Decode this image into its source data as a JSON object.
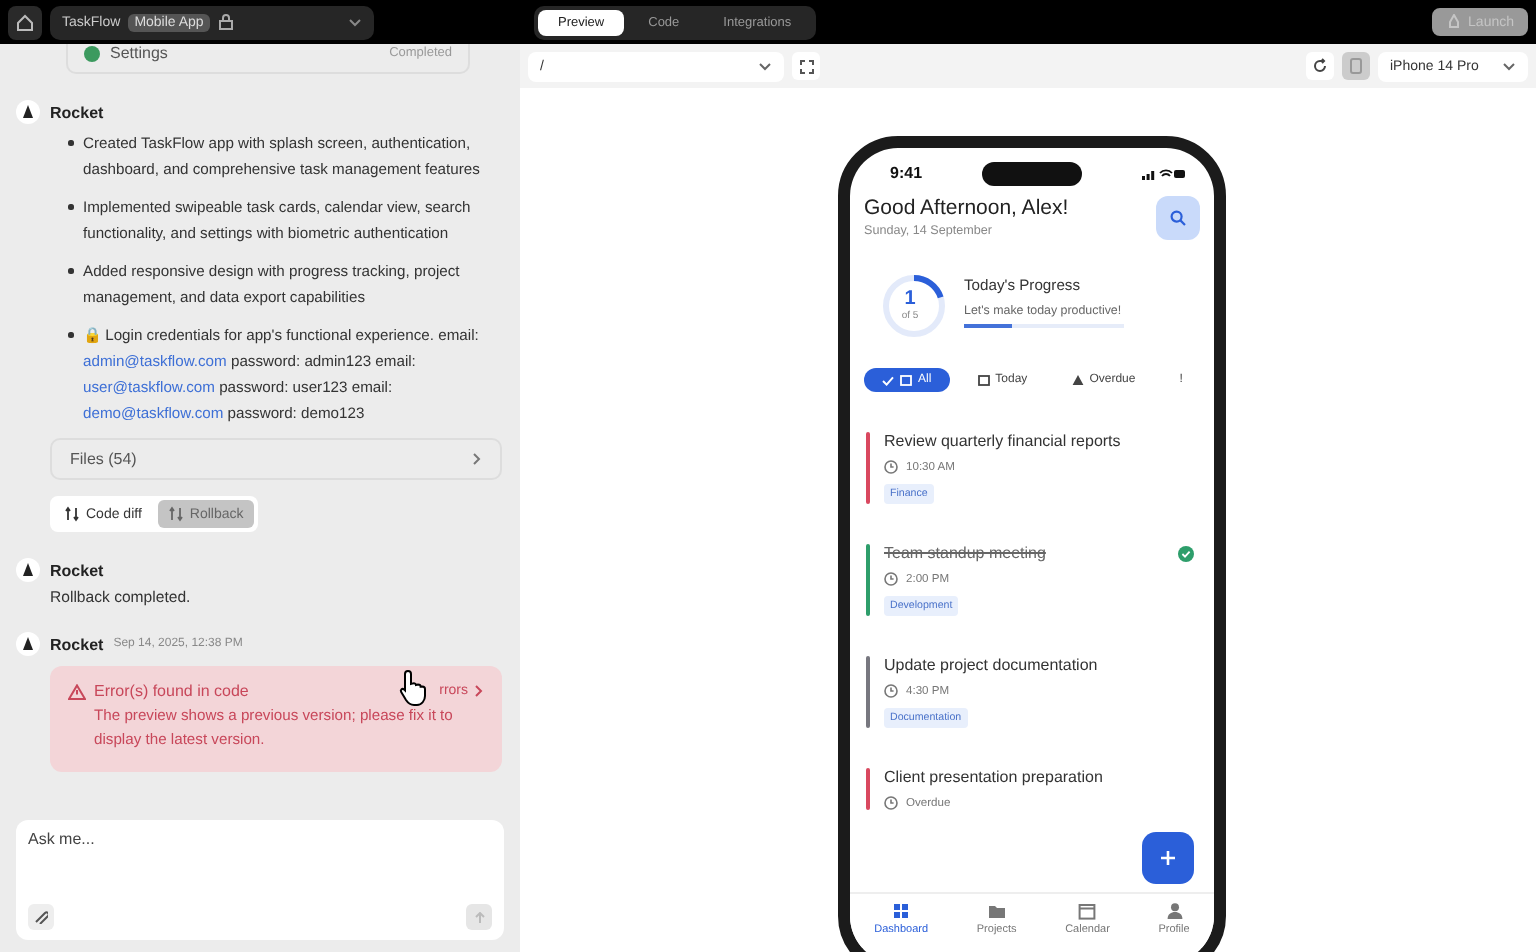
{
  "top_bar": {
    "project_name": "TaskFlow",
    "project_badge": "Mobile App",
    "tabs": [
      {
        "label": "Preview",
        "selected": true
      },
      {
        "label": "Code",
        "selected": false
      },
      {
        "label": "Integrations",
        "selected": false
      }
    ],
    "launch_button": {
      "label": "Launch",
      "disabled": true
    }
  },
  "chat": {
    "prev_item": {
      "label": "Settings",
      "status": "Completed"
    },
    "messages": [
      {
        "kind": "summary",
        "author": "Rocket",
        "bullets": [
          "Created TaskFlow app with splash screen, authentication, dashboard, and comprehensive task management features",
          "Implemented swipeable task cards, calendar view, search functionality, and settings with biometric authentication",
          "Added responsive design with progress tracking, project management, and data export capabilities"
        ],
        "credentials": {
          "intro": "🔒 Login credentials for app's functional experience. email:",
          "accounts": [
            {
              "email": "admin@taskflow.com",
              "rest": "password: admin123 email:"
            },
            {
              "email": "user@taskflow.com",
              "rest": "password: user123 email:"
            },
            {
              "email": "demo@taskflow.com",
              "rest": "password: demo123"
            }
          ]
        },
        "files": "Files (54)",
        "actions": [
          {
            "label": "Code diff",
            "disabled": false
          },
          {
            "label": "Rollback",
            "disabled": true
          }
        ]
      },
      {
        "kind": "text",
        "author": "Rocket",
        "text": "Rollback completed."
      },
      {
        "kind": "error",
        "author": "Rocket",
        "time": "Sep 14, 2025, 12:38 PM",
        "title": "Error(s) found in code",
        "link": "rrors",
        "text": "The preview shows a previous version; please fix it to display the latest version."
      }
    ],
    "input": {
      "placeholder": "Ask me..."
    }
  },
  "preview": {
    "path": "/",
    "device": "iPhone 14 Pro",
    "phone": {
      "time": "9:41",
      "greeting": "Good Afternoon, Alex!",
      "date": "Sunday, 14 September",
      "progress": {
        "done": "1",
        "total": "of 5",
        "ring": {
          "level": 0.2
        },
        "title": "Today's Progress",
        "subtitle": "Let's make today productive!",
        "bar": {
          "level": 0.3
        }
      },
      "filters": [
        {
          "label": "All",
          "selected": true
        },
        {
          "label": "Today",
          "selected": false
        },
        {
          "label": "Overdue",
          "selected": false
        },
        {
          "label": "!",
          "selected": false
        }
      ],
      "tasks": [
        {
          "title": "Review quarterly financial reports",
          "time": "10:30 AM",
          "tag": "Finance",
          "color": "#d9485f",
          "completed": false
        },
        {
          "title": "Team standup meeting",
          "time": "2:00 PM",
          "tag": "Development",
          "color": "#2e9e6b",
          "completed": true
        },
        {
          "title": "Update project documentation",
          "time": "4:30 PM",
          "tag": "Documentation",
          "color": "#77777f",
          "completed": false
        },
        {
          "title": "Client presentation preparation",
          "time": "Overdue",
          "color": "#d9485f",
          "completed": false
        }
      ],
      "nav": [
        {
          "label": "Dashboard",
          "selected": true
        },
        {
          "label": "Projects",
          "selected": false
        },
        {
          "label": "Calendar",
          "selected": false
        },
        {
          "label": "Profile",
          "selected": false
        }
      ]
    }
  }
}
